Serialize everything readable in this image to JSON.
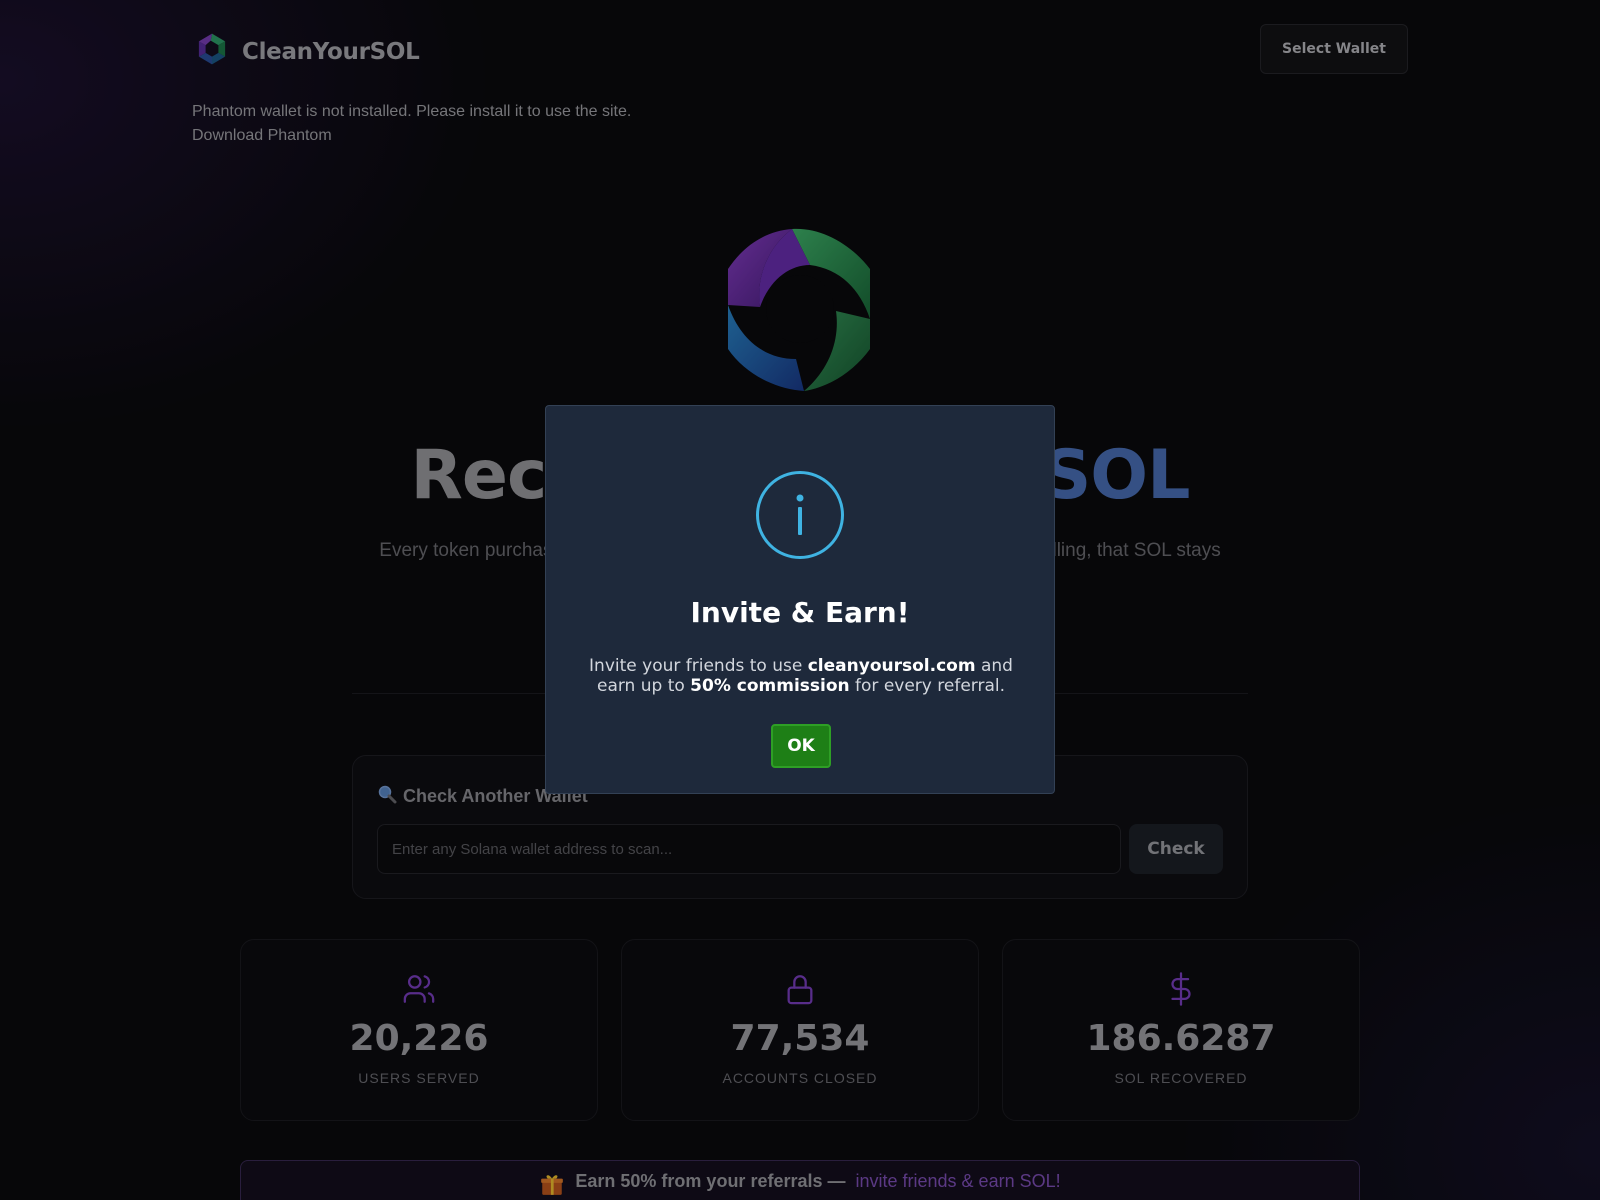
{
  "header": {
    "brand_name": "CleanYourSOL",
    "select_wallet_label": "Select Wallet"
  },
  "notice": {
    "message": "Phantom wallet is not installed. Please install it to use the site.",
    "download_link": "Download Phantom"
  },
  "hero": {
    "title_visible_left": "Rec",
    "title_visible_right": "SOL",
    "subtitle_visible_left": "Every token purchas",
    "subtitle_visible_right": "lling, that SOL stays"
  },
  "check_wallet": {
    "icon": "magnifier-icon",
    "title": "Check Another Wallet",
    "input_value": "",
    "input_placeholder": "Enter any Solana wallet address to scan...",
    "button_label": "Check"
  },
  "stats": [
    {
      "icon": "users-icon",
      "value": "20,226",
      "label": "USERS SERVED"
    },
    {
      "icon": "lock-icon",
      "value": "77,534",
      "label": "ACCOUNTS CLOSED"
    },
    {
      "icon": "dollar-icon",
      "value": "186.6287",
      "label": "SOL RECOVERED"
    }
  ],
  "referral_banner": {
    "icon": "gift-icon",
    "text": "Earn 50% from your referrals —",
    "link": "invite friends & earn SOL!"
  },
  "modal": {
    "icon": "info-icon",
    "title": "Invite & Earn!",
    "text_1": "Invite your friends to use ",
    "domain": "cleanyoursol.com",
    "text_2": " and earn up to ",
    "commission": "50% commission",
    "text_3": " for every referral.",
    "ok_label": "OK"
  },
  "colors": {
    "background": "#0a0a0d",
    "modal_bg": "#1e293b",
    "info_icon": "#3fb3e2",
    "ok_button": "#1e7f16",
    "accent_purple": "#7f4fb8",
    "title_accent": "#4a6fb8"
  }
}
